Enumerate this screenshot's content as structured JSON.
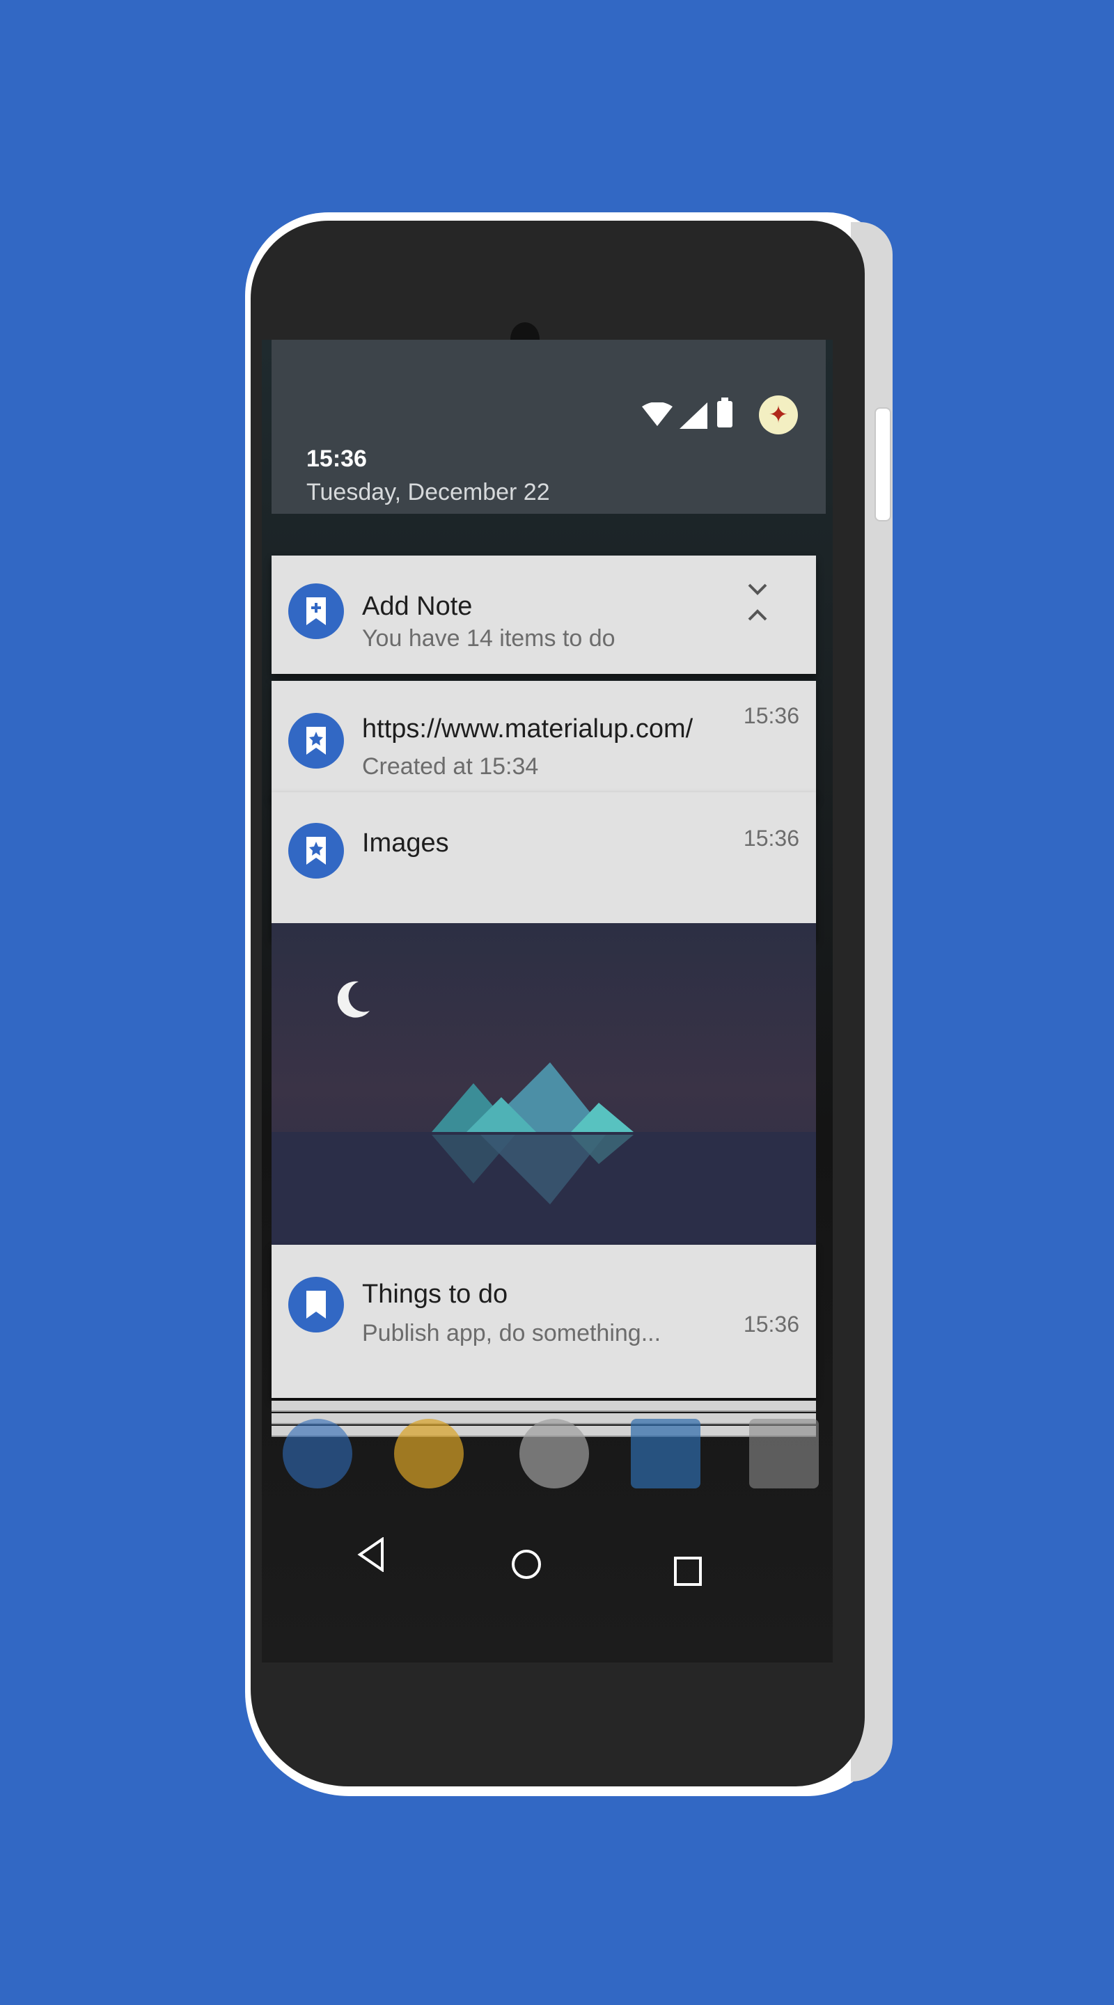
{
  "status_bar": {
    "time": "15:36",
    "date": "Tuesday, December 22"
  },
  "notifications": [
    {
      "title": "Add Note",
      "subtitle": "You have 14 items to do",
      "time": ""
    },
    {
      "title": "https://www.materialup.com/",
      "subtitle": "Created at 15:34",
      "time": "15:36"
    },
    {
      "title": "Images",
      "subtitle": "",
      "time": "15:36"
    },
    {
      "title": "Things to do",
      "subtitle": "Publish app, do something...",
      "time": "15:36"
    }
  ],
  "colors": {
    "background": "#3268c4",
    "accent": "#3268c4",
    "card": "#e1e1e1",
    "shade_header": "#3d444a"
  },
  "icons": {
    "note": "bookmark-plus-icon",
    "bookmark_star": "bookmark-star-icon",
    "bookmark": "bookmark-icon",
    "collapse": "collapse-icon"
  }
}
